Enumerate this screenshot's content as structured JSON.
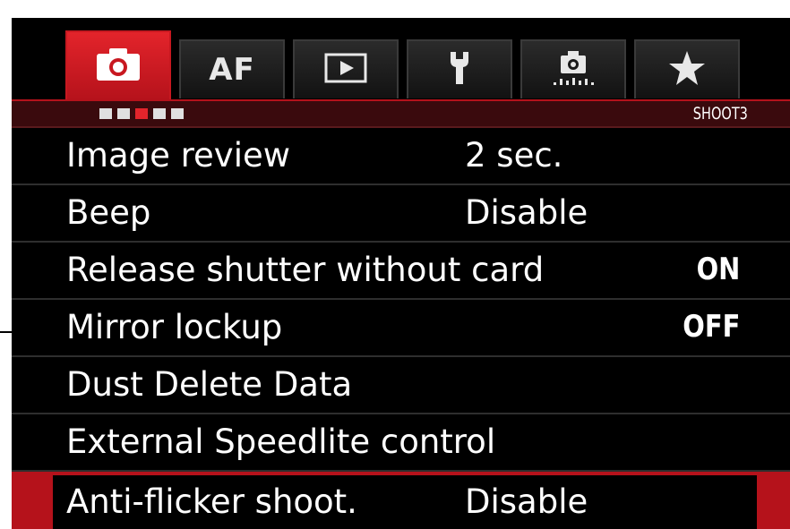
{
  "tabs": [
    {
      "name": "shoot",
      "icon": "camera-icon",
      "active": true
    },
    {
      "name": "af",
      "label": "AF",
      "active": false
    },
    {
      "name": "playback",
      "icon": "play-icon",
      "active": false
    },
    {
      "name": "setup",
      "icon": "wrench-icon",
      "active": false
    },
    {
      "name": "custom",
      "icon": "custom-function-camera-icon",
      "active": false
    },
    {
      "name": "mymenu",
      "icon": "star-icon",
      "active": false
    }
  ],
  "subbar": {
    "label": "SHOOT3",
    "page_count": 5,
    "current_page": 3
  },
  "menu": {
    "items": [
      {
        "label": "Image review",
        "value": "2 sec."
      },
      {
        "label": "Beep",
        "value": "Disable"
      },
      {
        "label": "Release shutter without card",
        "value": "ON"
      },
      {
        "label": "Mirror lockup",
        "value": "OFF"
      },
      {
        "label": "Dust Delete Data",
        "value": ""
      },
      {
        "label": "External Speedlite control",
        "value": ""
      },
      {
        "label": "Anti-flicker shoot.",
        "value": "Disable"
      }
    ],
    "selected_index": 6
  },
  "colors": {
    "accent": "#e3242b",
    "accent_dark": "#b5121b",
    "subbar_bg": "#3a0a0d",
    "background": "#000000",
    "text": "#ffffff"
  }
}
